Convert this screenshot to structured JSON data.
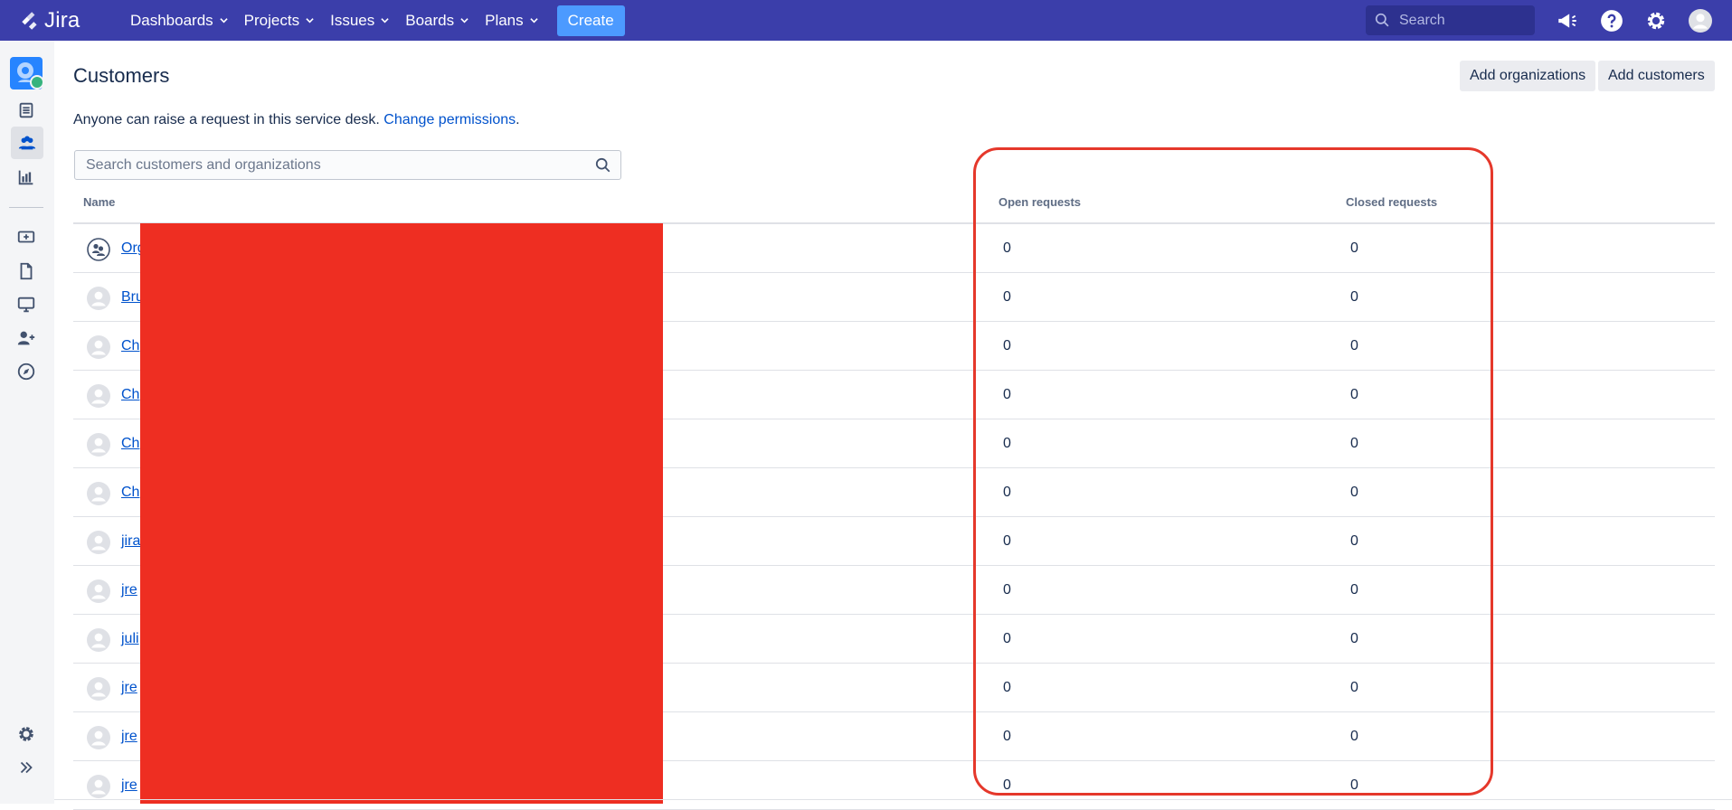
{
  "topbar": {
    "logo_text": "Jira",
    "nav": [
      "Dashboards",
      "Projects",
      "Issues",
      "Boards",
      "Plans"
    ],
    "create_label": "Create",
    "search_placeholder": "Search"
  },
  "sidebar": {
    "icons": [
      "pages-icon",
      "customers-icon",
      "reports-icon",
      "queues-icon",
      "document-icon",
      "monitor-icon",
      "add-user-icon",
      "compass-icon",
      "settings-icon",
      "expand-icon"
    ]
  },
  "page": {
    "title": "Customers",
    "add_organizations_label": "Add organizations",
    "add_customers_label": "Add customers",
    "permission_text": "Anyone can raise a request in this service desk. ",
    "permission_link": "Change permissions",
    "permission_suffix": ".",
    "search_placeholder": "Search customers and organizations"
  },
  "table": {
    "headers": {
      "name": "Name",
      "open": "Open requests",
      "closed": "Closed requests"
    },
    "rows": [
      {
        "name": "Org",
        "type": "organization",
        "open": "0",
        "closed": "0"
      },
      {
        "name": "Bru",
        "type": "user",
        "open": "0",
        "closed": "0"
      },
      {
        "name": "Ch",
        "type": "user",
        "open": "0",
        "closed": "0"
      },
      {
        "name": "Ch",
        "type": "user",
        "open": "0",
        "closed": "0"
      },
      {
        "name": "Ch",
        "type": "user",
        "open": "0",
        "closed": "0"
      },
      {
        "name": "Ch",
        "type": "user",
        "open": "0",
        "closed": "0"
      },
      {
        "name": "jira",
        "type": "user",
        "open": "0",
        "closed": "0"
      },
      {
        "name": "jre",
        "type": "user",
        "open": "0",
        "closed": "0"
      },
      {
        "name": "juli",
        "type": "user",
        "open": "0",
        "closed": "0"
      },
      {
        "name": "jre",
        "type": "user",
        "open": "0",
        "closed": "0"
      },
      {
        "name": "jre",
        "type": "user",
        "open": "0",
        "closed": "0"
      },
      {
        "name": "jre",
        "type": "user",
        "open": "0",
        "closed": "0"
      }
    ]
  },
  "colors": {
    "topbar": "#3b3eaa",
    "link": "#0052cc",
    "redaction": "#ee2e22",
    "highlight": "#e5382b"
  }
}
